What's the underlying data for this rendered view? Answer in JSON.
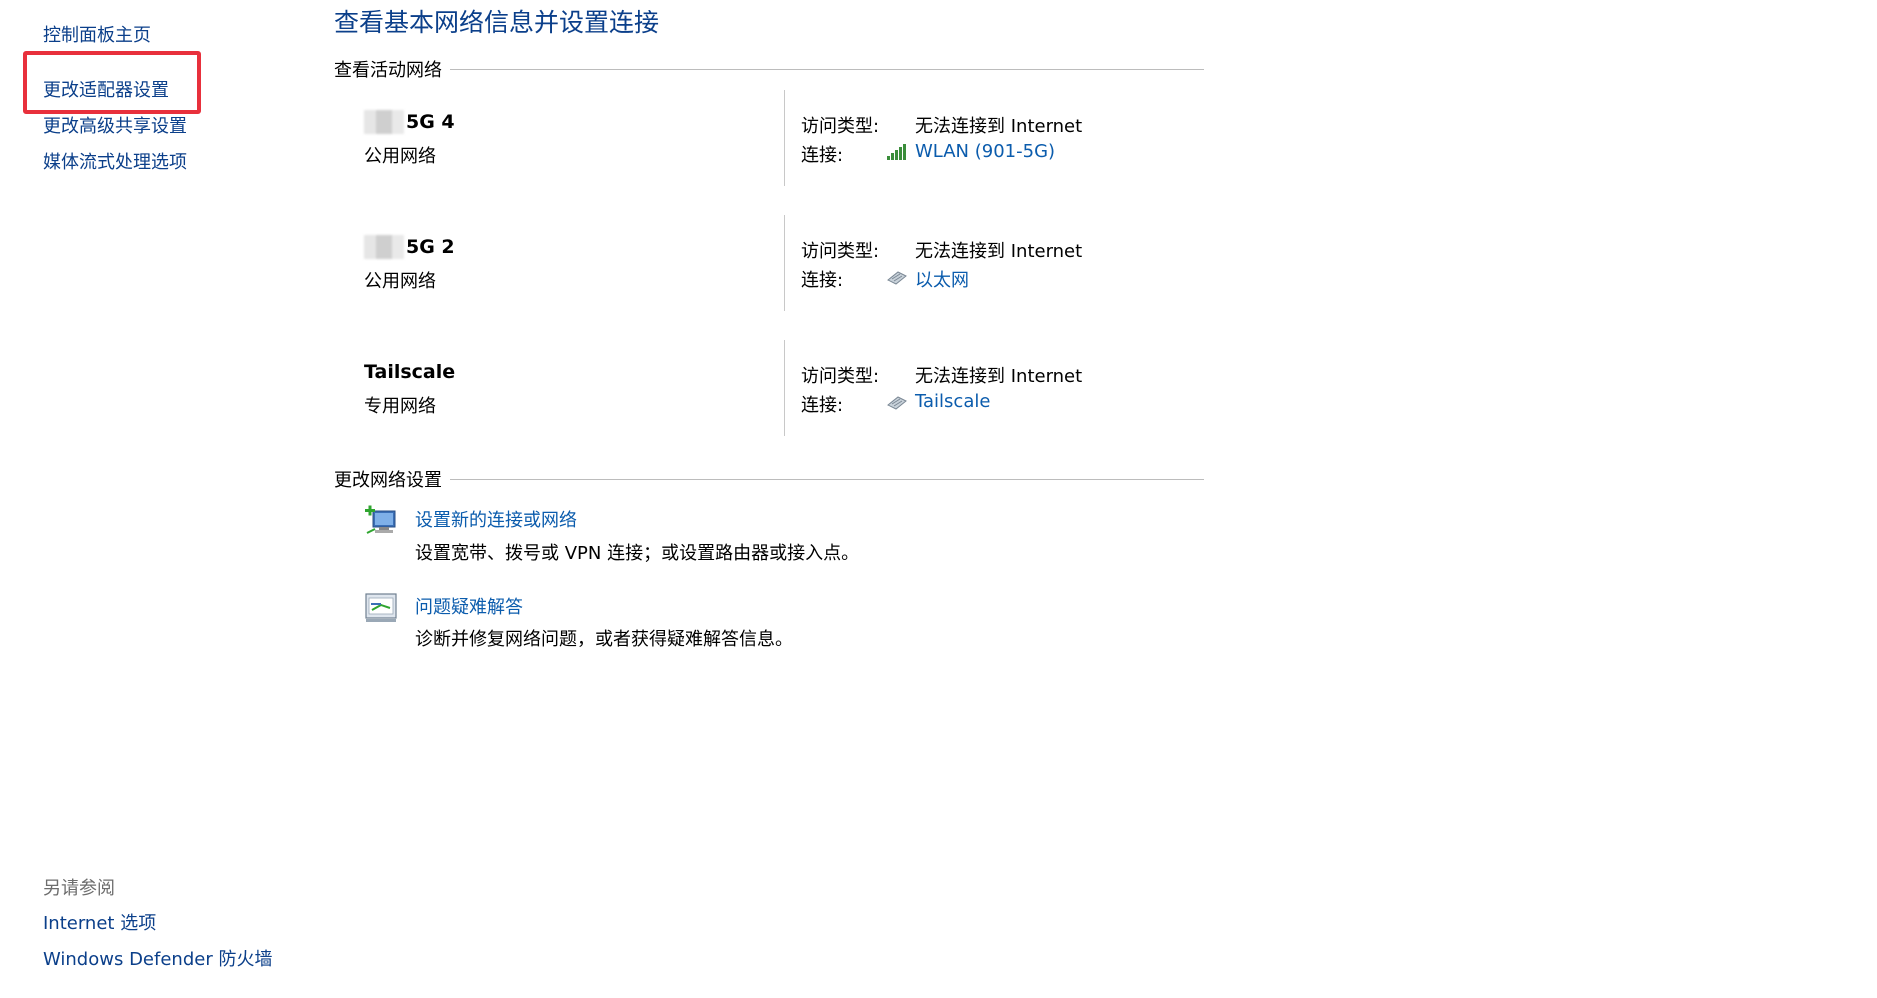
{
  "sidebar": {
    "links": [
      {
        "label": "控制面板主页"
      },
      {
        "label": "更改适配器设置"
      },
      {
        "label": "更改高级共享设置"
      },
      {
        "label": "媒体流式处理选项"
      }
    ],
    "see_also_title": "另请参阅",
    "see_also_links": [
      {
        "label": "Internet 选项"
      },
      {
        "label": "Windows Defender 防火墙"
      }
    ],
    "highlight_color": "#e8303c"
  },
  "main": {
    "title": "查看基本网络信息并设置连接",
    "active_networks_header": "查看活动网络",
    "networks": [
      {
        "name": "5G 4",
        "type": "公用网络",
        "access_label": "访问类型:",
        "access_value": "无法连接到 Internet",
        "conn_label": "连接:",
        "conn_value": "WLAN (901-5G)",
        "conn_icon": "wifi-signal-icon"
      },
      {
        "name": "5G 2",
        "type": "公用网络",
        "access_label": "访问类型:",
        "access_value": "无法连接到 Internet",
        "conn_label": "连接:",
        "conn_value": "以太网",
        "conn_icon": "ethernet-icon"
      },
      {
        "name": "Tailscale",
        "type": "专用网络",
        "access_label": "访问类型:",
        "access_value": "无法连接到 Internet",
        "conn_label": "连接:",
        "conn_value": "Tailscale",
        "conn_icon": "ethernet-icon"
      }
    ],
    "change_settings_header": "更改网络设置",
    "tasks": [
      {
        "link": "设置新的连接或网络",
        "desc": "设置宽带、拨号或 VPN 连接；或设置路由器或接入点。",
        "icon": "new-connection-icon"
      },
      {
        "link": "问题疑难解答",
        "desc": "诊断并修复网络问题，或者获得疑难解答信息。",
        "icon": "troubleshoot-icon"
      }
    ]
  },
  "colors": {
    "title_blue": "#0b3f8a",
    "link_blue": "#0b5cad",
    "divider": "#bcbcbc"
  }
}
